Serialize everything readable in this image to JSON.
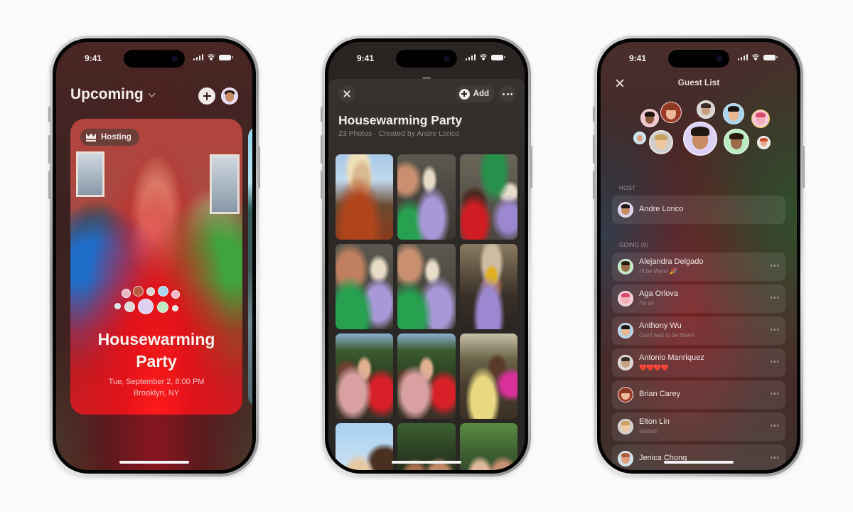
{
  "status_bar": {
    "time": "9:41"
  },
  "phone1": {
    "header": {
      "title": "Upcoming",
      "add_button": "plus-icon",
      "profile": "avatar"
    },
    "event_card": {
      "badge": "Hosting",
      "title": "Housewarming Party",
      "title_line1": "Housewarming",
      "title_line2": "Party",
      "date": "Tue, September 2, 8:00 PM",
      "location": "Brooklyn, NY"
    }
  },
  "phone2": {
    "toolbar": {
      "close": "close-icon",
      "add_label": "Add",
      "more": "more-icon"
    },
    "album": {
      "title": "Housewarming Party",
      "subtitle": "23 Photos · Created by Andre Lorico",
      "photo_count": 23
    }
  },
  "phone3": {
    "title": "Guest List",
    "host_section": "HOST",
    "host": {
      "name": "Andre Lorico"
    },
    "going_section": "GOING (9)",
    "guests": [
      {
        "name": "Alejandra Delgado",
        "message": "I'll be there! 🎉"
      },
      {
        "name": "Aga Orlova",
        "message": "I'm in!"
      },
      {
        "name": "Anthony Wu",
        "message": "Can't wait to be there!"
      },
      {
        "name": "Antonio Manriquez",
        "message": "❤️❤️❤️❤️"
      },
      {
        "name": "Brian Carey",
        "message": ""
      },
      {
        "name": "Elton Lin",
        "message": "stoked!"
      },
      {
        "name": "Jenica Chong",
        "message": ""
      }
    ]
  },
  "colors": {
    "background": "#fafafa",
    "card_red": "#e0121a",
    "sheet_dark": "#2c2826",
    "heart_red": "#e0242c"
  }
}
